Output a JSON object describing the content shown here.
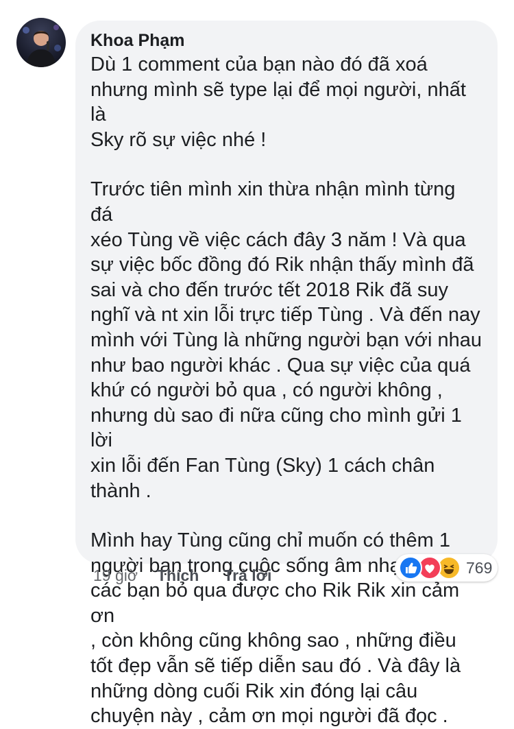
{
  "comment": {
    "author": "Khoa Phạm",
    "paragraphs": [
      "Dù 1 comment của bạn nào đó đã xoá\nnhưng mình sẽ type lại để mọi người, nhất là\nSky rõ sự việc nhé !",
      "Trước tiên mình xin thừa nhận mình từng đá\nxéo Tùng về việc cách đây 3 năm ! Và qua\nsự việc bốc đồng đó Rik nhận thấy mình đã\nsai và cho đến trước tết 2018 Rik đã suy\nnghĩ và nt xin lỗi trực tiếp Tùng . Và đến nay\nmình với Tùng là những người bạn với nhau\nnhư bao người khác . Qua sự việc của quá\nkhứ có người bỏ qua , có người không ,\nnhưng dù sao đi nữa cũng cho mình gửi 1 lời\nxin lỗi đến Fan Tùng (Sky) 1 cách chân\nthành .",
      "Mình hay Tùng cũng chỉ muốn có thêm 1\nngười bạn trong cuộc sống âm nhạc , nếu\ncác bạn bỏ qua được cho Rik Rik xin cảm ơn\n, còn không cũng không sao , những điều\ntốt đẹp vẫn sẽ tiếp diễn sau đó . Và đây là\nnhững dòng cuối Rik xin đóng lại câu\nchuyện này , cảm ơn mọi người đã đọc ."
    ]
  },
  "actions": {
    "time": "19 giờ",
    "like_label": "Thích",
    "reply_label": "Trả lời"
  },
  "reactions": {
    "icons": [
      "like-icon",
      "love-icon",
      "haha-icon"
    ],
    "count": "769",
    "colors": {
      "like": "#1877f2",
      "love": "#f33e58",
      "haha": "#f7b928"
    }
  }
}
